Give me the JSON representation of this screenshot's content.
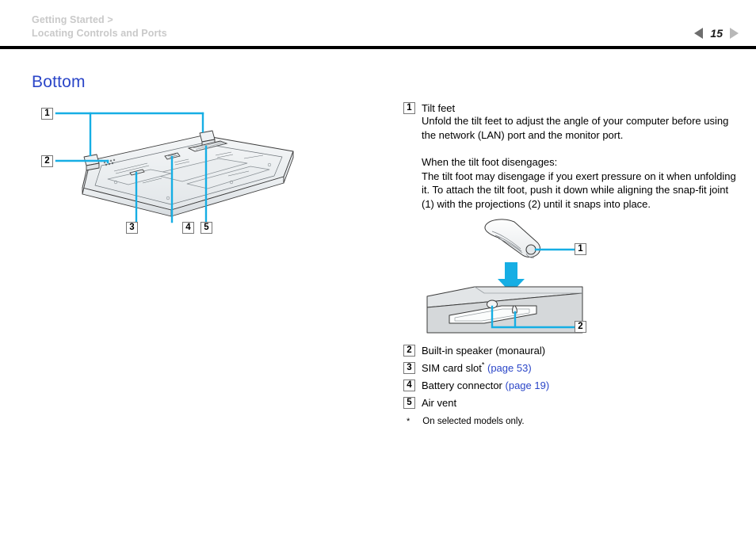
{
  "header": {
    "breadcrumb_line1": "Getting Started >",
    "breadcrumb_line2": "Locating Controls and Ports",
    "page_number": "15",
    "prev_icon": "triangle-left-icon",
    "next_icon": "triangle-right-icon"
  },
  "section": {
    "title": "Bottom"
  },
  "figure_left": {
    "alt": "Bottom view of notebook computer",
    "callouts": [
      {
        "num": "1"
      },
      {
        "num": "2"
      },
      {
        "num": "3"
      },
      {
        "num": "4"
      },
      {
        "num": "5"
      }
    ]
  },
  "item1": {
    "num": "1",
    "title": "Tilt feet",
    "para1": "Unfold the tilt feet to adjust the angle of your computer before using the network (LAN) port and the monitor port.",
    "para2_heading": "When the tilt foot disengages:",
    "para2": "The tilt foot may disengage if you exert pressure on it when unfolding it. To attach the tilt foot, push it down while aligning the snap-fit joint (1) with the projections (2) until it snaps into place."
  },
  "figure_detail": {
    "alt": "Tilt foot snap-fit attachment detail",
    "callouts": [
      {
        "num": "1"
      },
      {
        "num": "2"
      }
    ]
  },
  "list": [
    {
      "num": "2",
      "label": "Built-in speaker (monaural)",
      "star": "",
      "link": ""
    },
    {
      "num": "3",
      "label": "SIM card slot",
      "star": "*",
      "link": "(page 53)"
    },
    {
      "num": "4",
      "label": "Battery connector",
      "star": "",
      "link": "(page 19)"
    },
    {
      "num": "5",
      "label": "Air vent",
      "star": "",
      "link": ""
    }
  ],
  "footnote": {
    "mark": "*",
    "text": "On selected models only."
  },
  "colors": {
    "accent_cyan": "#16AEE4",
    "link_blue": "#2b46c8",
    "heading_blue": "#2b46c8",
    "breadcrumb_gray": "#c9c9c9"
  }
}
